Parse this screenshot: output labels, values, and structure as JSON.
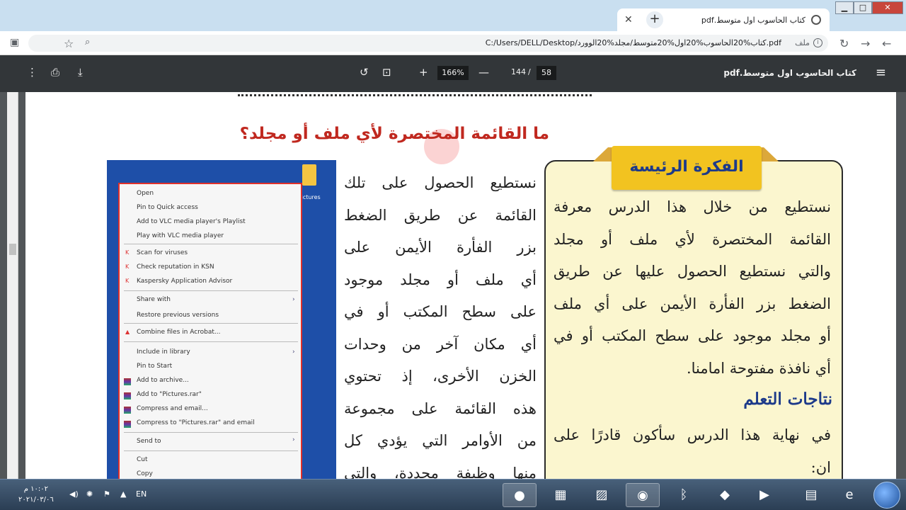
{
  "window": {
    "tab_title": "كتاب الحاسوب اول متوسط.pdf",
    "tab_close": "✕",
    "new_tab": "+",
    "minimize": "▁",
    "maximize": "□",
    "close": "✕"
  },
  "address": {
    "file_label": "ملف",
    "url": "C:/Users/DELL/Desktop/كتاب%20الحاسوب%20اول%20متوسط/مجلد%20الوورد.pdf"
  },
  "pdf_toolbar": {
    "title": "كتاب الحاسوب اول متوسط.pdf",
    "current_page": "58",
    "separator": "/",
    "total_pages": "144",
    "zoom": "166%",
    "zoom_in": "+",
    "zoom_out": "—"
  },
  "page": {
    "heading": "ما القائمة المختصرة لأي ملف أو مجلد؟",
    "body_lines": [
      "نستطيع الحصول على تلك",
      "القائمة عن طريق الضغط",
      "بزر الفأرة الأيمن على",
      "أي ملف أو مجلد موجود",
      "على سطح المكتب أو في",
      "أي مكان آخر من وحدات",
      "الخزن الأخرى، إذ تحتوي",
      "هذه القائمة على مجموعة",
      "من الأوامر التي يؤدي كل",
      "منها وظيفة محددة، والتي"
    ],
    "idea_title": "الفكرة الرئيسة",
    "idea_lines": [
      "نستطيع من خلال هذا الدرس معرفة",
      "القائمة المختصرة لأي ملف أو مجلد",
      "والتي نستطيع الحصول عليها عن طريق",
      "الضغط بزر الفأرة الأيمن على أي ملف",
      "أو مجلد موجود على سطح المكتب أو في",
      "أي نافذة مفتوحة امامنا."
    ],
    "outcomes_title": "نتاجات التعلم",
    "outcome_lines": [
      "في نهاية هذا الدرس سأكون قادرًا على",
      "ان:"
    ]
  },
  "context_menu": {
    "items": [
      "Open",
      "Pin to Quick access",
      "Add to VLC media player's Playlist",
      "Play with VLC media player",
      "Scan for viruses",
      "Check reputation in KSN",
      "Kaspersky Application Advisor",
      "Share with",
      "Restore previous versions",
      "Combine files in Acrobat...",
      "Include in library",
      "Pin to Start",
      "Add to archive...",
      "Add to \"Pictures.rar\"",
      "Compress and email...",
      "Compress to \"Pictures.rar\" and email",
      "Send to",
      "Cut",
      "Copy"
    ],
    "folder_label": "Pictures"
  },
  "taskbar": {
    "time": "١٠:٠٢ م",
    "date": "٢٠٢١/٠٣/٠٦",
    "language": "EN"
  }
}
